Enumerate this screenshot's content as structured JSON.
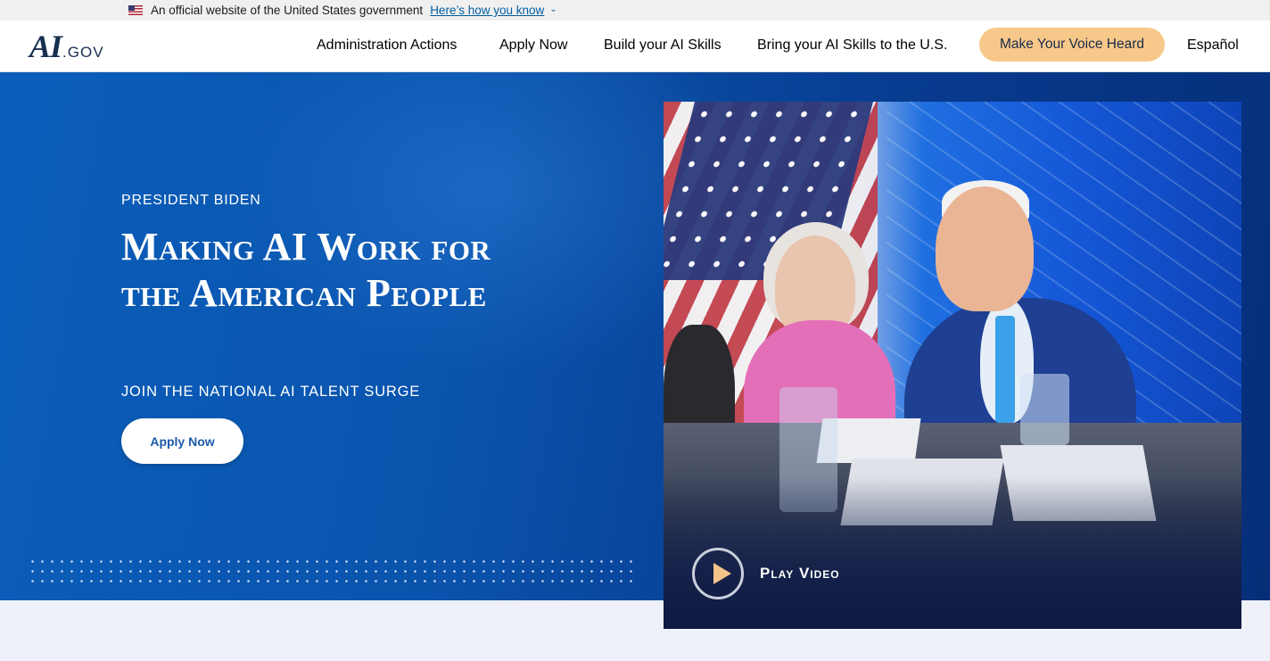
{
  "gov_banner": {
    "text": "An official website of the United States government",
    "link": "Here’s how you know"
  },
  "header": {
    "logo_main": "AI",
    "logo_suffix": ".GOV",
    "nav": [
      "Administration Actions",
      "Apply Now",
      "Build your AI Skills",
      "Bring your AI Skills to the U.S.",
      "Make Your Voice Heard",
      "Español"
    ]
  },
  "hero": {
    "eyebrow": "PRESIDENT BIDEN",
    "headline": "Making AI Work for the American People",
    "subline": "JOIN THE NATIONAL AI TALENT SURGE",
    "cta": "Apply Now",
    "video_label": "Play Video"
  },
  "colors": {
    "hero_blue": "#0a53ad",
    "navy_text": "#162e51",
    "voice_button": "#f7c889",
    "gov_link": "#005ea2"
  }
}
